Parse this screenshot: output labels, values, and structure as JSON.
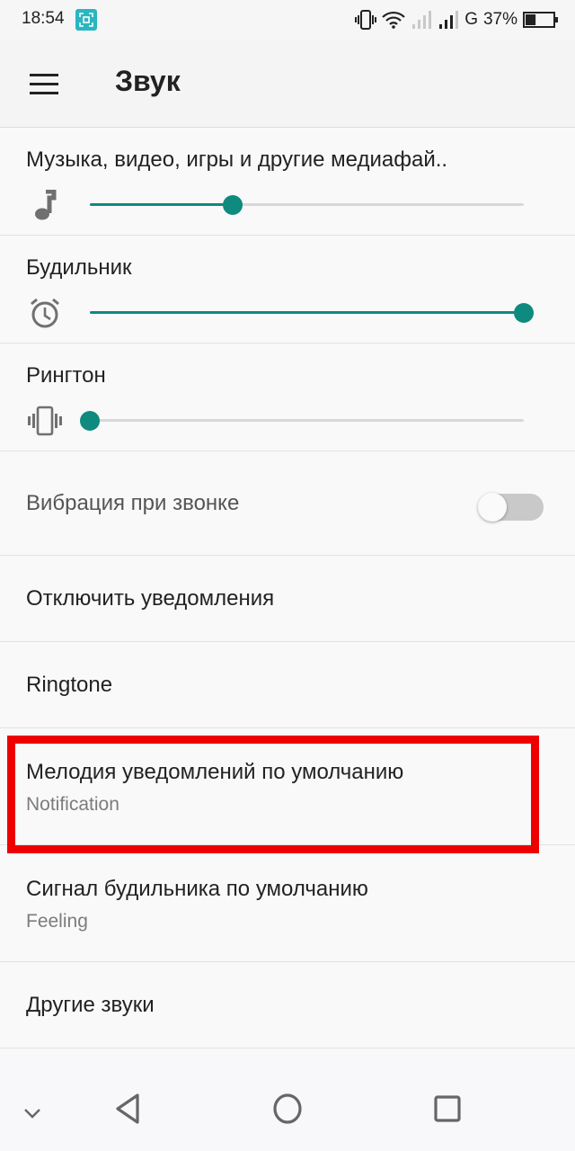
{
  "status_bar": {
    "time": "18:54",
    "network_type": "G",
    "battery_percent": "37%",
    "battery_level": 0.37,
    "icons": [
      "screenshot-icon",
      "vibrate-icon",
      "wifi-icon",
      "signal-sim1-icon",
      "signal-sim2-icon",
      "battery-icon"
    ]
  },
  "app_bar": {
    "title": "Звук",
    "menu_icon": "hamburger-menu-icon"
  },
  "volume_sliders": [
    {
      "label": "Музыка, видео, игры и другие медиафай..",
      "icon": "music-note-icon",
      "value": 0.33
    },
    {
      "label": "Будильник",
      "icon": "alarm-clock-icon",
      "value": 1.0
    },
    {
      "label": "Рингтон",
      "icon": "vibrate-icon",
      "value": 0.0
    }
  ],
  "settings": {
    "vibrate_on_ring": {
      "label": "Вибрация при звонке",
      "enabled": false
    },
    "do_not_disturb": {
      "label": "Отключить уведомления"
    },
    "ringtone": {
      "label": "Ringtone"
    },
    "default_notification": {
      "label": "Мелодия уведомлений по умолчанию",
      "value": "Notification",
      "highlighted": true
    },
    "default_alarm": {
      "label": "Сигнал будильника по умолчанию",
      "value": "Feeling"
    },
    "other_sounds": {
      "label": "Другие звуки"
    }
  },
  "colors": {
    "accent": "#0e8a7f",
    "highlight": "#ee0000",
    "screenshot_badge": "#29b6c1"
  },
  "nav_bar": {
    "items": [
      "hide-nav-chevron-icon",
      "back-icon",
      "home-icon",
      "recents-icon"
    ]
  }
}
